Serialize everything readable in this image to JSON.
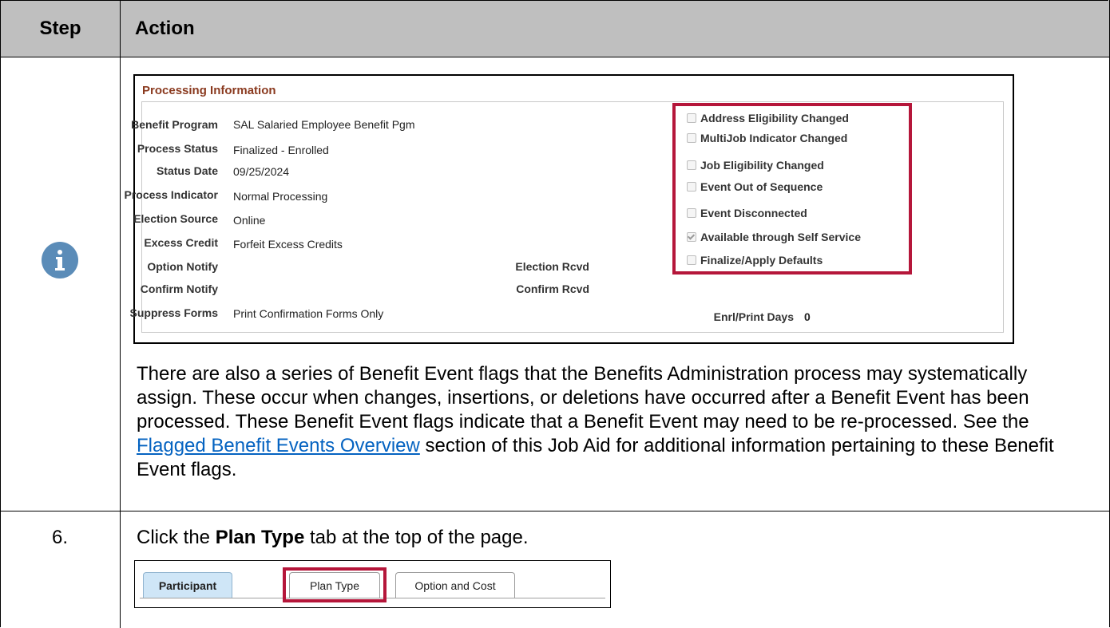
{
  "header": {
    "step": "Step",
    "action": "Action"
  },
  "processing": {
    "title": "Processing Information",
    "fields": [
      {
        "label": "Benefit Program",
        "value": "SAL Salaried Employee Benefit Pgm"
      },
      {
        "label": "Process Status",
        "value": "Finalized - Enrolled"
      },
      {
        "label": "Status Date",
        "value": "09/25/2024"
      },
      {
        "label": "Process Indicator",
        "value": "Normal Processing"
      },
      {
        "label": "Election Source",
        "value": "Online"
      },
      {
        "label": "Excess Credit",
        "value": "Forfeit Excess Credits"
      },
      {
        "label": "Option Notify",
        "value": ""
      },
      {
        "label": "Confirm Notify",
        "value": ""
      },
      {
        "label": "Suppress Forms",
        "value": "Print Confirmation Forms Only"
      }
    ],
    "election_rcvd_label": "Election Rcvd",
    "confirm_rcvd_label": "Confirm Rcvd",
    "enrl_print_days_label": "Enrl/Print Days",
    "enrl_print_days_value": "0",
    "flags": [
      {
        "label": "Address Eligibility Changed",
        "checked": false
      },
      {
        "label": "MultiJob Indicator Changed",
        "checked": false
      },
      {
        "label": "Job Eligibility Changed",
        "checked": false
      },
      {
        "label": "Event Out of Sequence",
        "checked": false
      },
      {
        "label": "Event Disconnected",
        "checked": false
      },
      {
        "label": "Available through Self Service",
        "checked": true
      },
      {
        "label": "Finalize/Apply Defaults",
        "checked": false
      }
    ]
  },
  "body": {
    "text_before_link": "There are also a series of Benefit Event flags that the Benefits Administration process may systematically assign.  These occur when changes, insertions, or deletions have occurred after a Benefit Event has been processed.  These Benefit Event flags indicate that a Benefit Event may need to be re-processed.  See the ",
    "link_text": "Flagged Benefit Events Overview",
    "text_after_link": " section of this Job Aid for additional information pertaining to these Benefit Event flags."
  },
  "step6": {
    "number": "6.",
    "text_before": "Click the ",
    "bold": "Plan Type",
    "text_after": " tab at the top of the page.",
    "tabs": [
      "Participant",
      "Plan Type",
      "Option and Cost"
    ]
  },
  "colors": {
    "highlight": "#b5163a",
    "header_bg": "#bfbfbf",
    "link": "#0563c1",
    "section_title": "#8a3a1f",
    "info_icon": "#5b8cb8"
  }
}
